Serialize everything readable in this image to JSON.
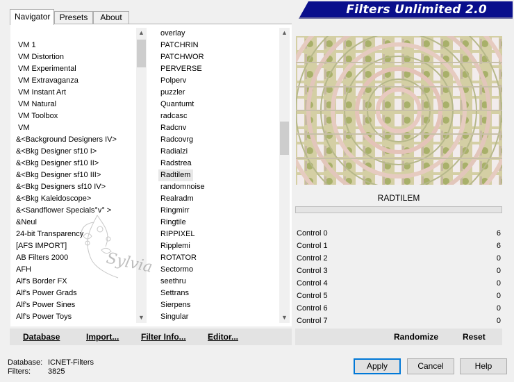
{
  "window": {
    "title": "Filters Unlimited 2.0"
  },
  "tabs": [
    {
      "label": "Navigator",
      "active": true
    },
    {
      "label": "Presets",
      "active": false
    },
    {
      "label": "About",
      "active": false
    }
  ],
  "categories": [
    "VM 1",
    "VM Distortion",
    "VM Experimental",
    "VM Extravaganza",
    "VM Instant Art",
    "VM Natural",
    "VM Toolbox",
    "VM",
    "&<Background Designers IV>",
    "&<Bkg Designer sf10 I>",
    "&<Bkg Designer sf10 II>",
    "&<Bkg Designer sf10 III>",
    "&<Bkg Designers sf10 IV>",
    "&<Bkg Kaleidoscope>",
    "&<Sandflower Specials°v° >",
    "&Neul",
    "24-bit Transparency",
    "[AFS IMPORT]",
    "AB Filters 2000",
    "AFH",
    "Alf's Border FX",
    "Alf's Power Grads",
    "Alf's Power Sines",
    "Alf's Power Toys"
  ],
  "filters": [
    "overlay",
    "PATCHRIN",
    "PATCHWOR",
    "PERVERSE",
    "Polperv",
    "puzzler",
    "Quantumt",
    "radcasc",
    "Radcnv",
    "Radcovrg",
    "Radialzi",
    "Radstrea",
    "Radtilem",
    "randomnoise",
    "Realradm",
    "Ringmirr",
    "Ringtile",
    "RIPPIXEL",
    "Ripplemi",
    "ROTATOR",
    "Sectormo",
    "seethru",
    "Settrans",
    "Sierpens",
    "Singular"
  ],
  "selected_filter_index": 12,
  "selected_filter_title": "RADTILEM",
  "watermark_text": "Sylvia",
  "controls": [
    {
      "name": "Control 0",
      "value": "6"
    },
    {
      "name": "Control 1",
      "value": "6"
    },
    {
      "name": "Control 2",
      "value": "0"
    },
    {
      "name": "Control 3",
      "value": "0"
    },
    {
      "name": "Control 4",
      "value": "0"
    },
    {
      "name": "Control 5",
      "value": "0"
    },
    {
      "name": "Control 6",
      "value": "0"
    },
    {
      "name": "Control 7",
      "value": "0"
    }
  ],
  "actions": {
    "database": "Database",
    "import": "Import...",
    "filter_info": "Filter Info...",
    "editor": "Editor...",
    "randomize": "Randomize",
    "reset": "Reset"
  },
  "status": {
    "database_label": "Database:",
    "database_value": "ICNET-Filters",
    "filters_label": "Filters:",
    "filters_value": "3825"
  },
  "buttons": {
    "apply": "Apply",
    "cancel": "Cancel",
    "help": "Help"
  },
  "colors": {
    "banner": "#0a0f8c",
    "selection": "#e8e8e8",
    "default_button_border": "#0078d7"
  }
}
